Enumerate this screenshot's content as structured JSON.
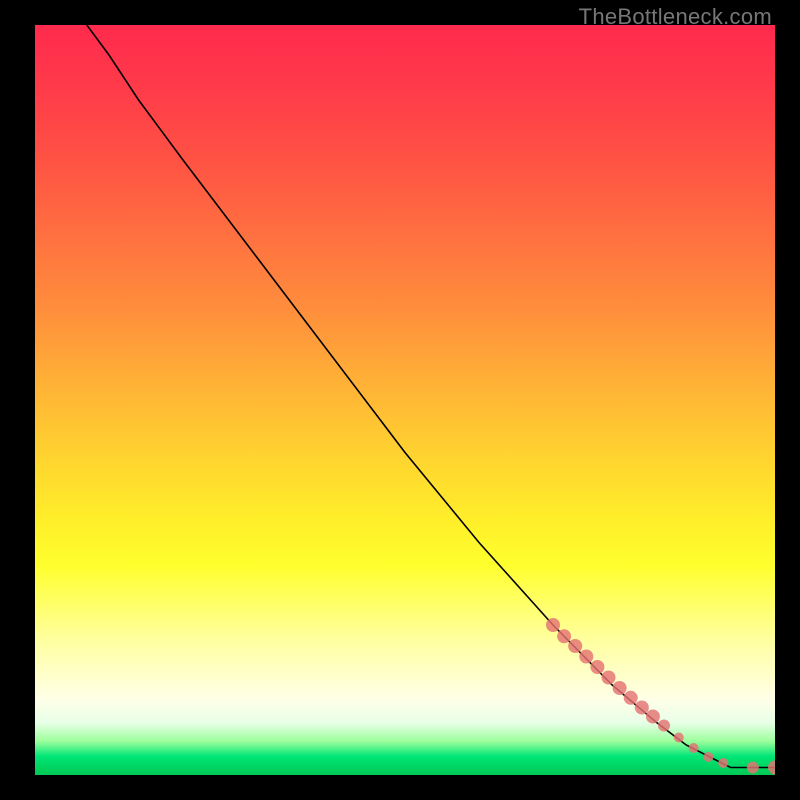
{
  "watermark": "TheBottleneck.com",
  "chart_data": {
    "type": "line",
    "title": "",
    "xlabel": "",
    "ylabel": "",
    "xlim": [
      0,
      100
    ],
    "ylim": [
      0,
      100
    ],
    "background_gradient": [
      "#ff2a4d",
      "#ffee2a",
      "#00c853"
    ],
    "series": [
      {
        "name": "curve",
        "x": [
          7,
          10,
          14,
          20,
          30,
          40,
          50,
          60,
          70,
          78,
          84,
          88,
          92,
          94,
          96,
          100
        ],
        "y": [
          100,
          96,
          90,
          82,
          69,
          56,
          43,
          31,
          20,
          12,
          7,
          4,
          2,
          1,
          1,
          1
        ]
      }
    ],
    "markers": {
      "name": "highlighted-points",
      "color": "#e57373",
      "x": [
        70,
        71.5,
        73,
        74.5,
        76,
        77.5,
        79,
        80.5,
        82,
        83.5,
        85,
        87,
        89,
        91,
        93,
        97,
        100
      ],
      "y": [
        20,
        18.5,
        17.2,
        15.8,
        14.4,
        13,
        11.6,
        10.3,
        9,
        7.8,
        6.6,
        5,
        3.6,
        2.4,
        1.6,
        1,
        1
      ],
      "r": [
        7,
        7,
        7,
        7,
        7,
        7,
        7,
        7,
        7,
        7,
        6,
        5,
        5,
        5,
        5,
        6,
        7
      ]
    }
  }
}
